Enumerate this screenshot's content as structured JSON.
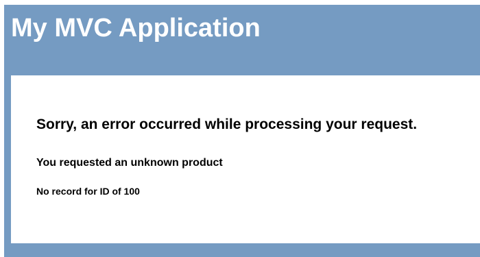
{
  "header": {
    "title": "My MVC Application"
  },
  "main": {
    "error_heading": "Sorry, an error occurred while processing your request.",
    "error_subheading": "You requested an unknown product",
    "error_detail": "No record for ID of 100"
  },
  "colors": {
    "page_background": "#759bc2",
    "content_background": "#ffffff",
    "header_text": "#ffffff",
    "body_text": "#000000"
  }
}
